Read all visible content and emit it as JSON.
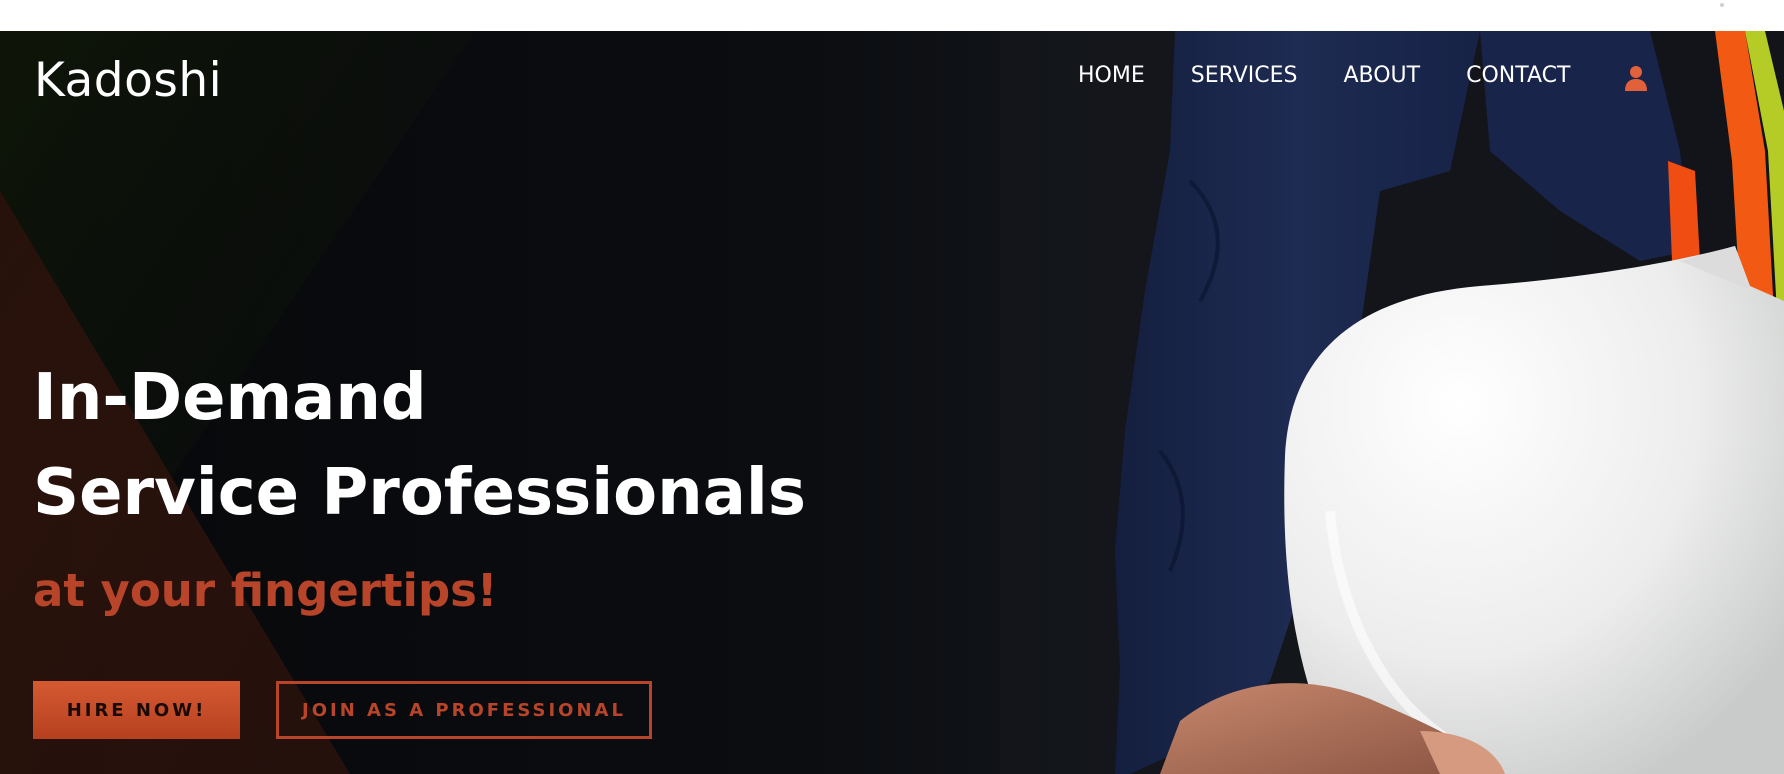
{
  "brand": {
    "name": "Kadoshi"
  },
  "nav": {
    "items": [
      {
        "label": "HOME"
      },
      {
        "label": "SERVICES"
      },
      {
        "label": "ABOUT"
      },
      {
        "label": "CONTACT"
      }
    ],
    "account_icon": "user-icon"
  },
  "hero": {
    "headline_line1": "In-Demand",
    "headline_line2": "Service Professionals",
    "tagline": "at your fingertips!",
    "primary_cta": "HIRE NOW!",
    "secondary_cta": "JOIN AS A PROFESSIONAL"
  },
  "colors": {
    "accent": "#b8452a",
    "background": "#0b0d11",
    "text": "#ffffff"
  }
}
